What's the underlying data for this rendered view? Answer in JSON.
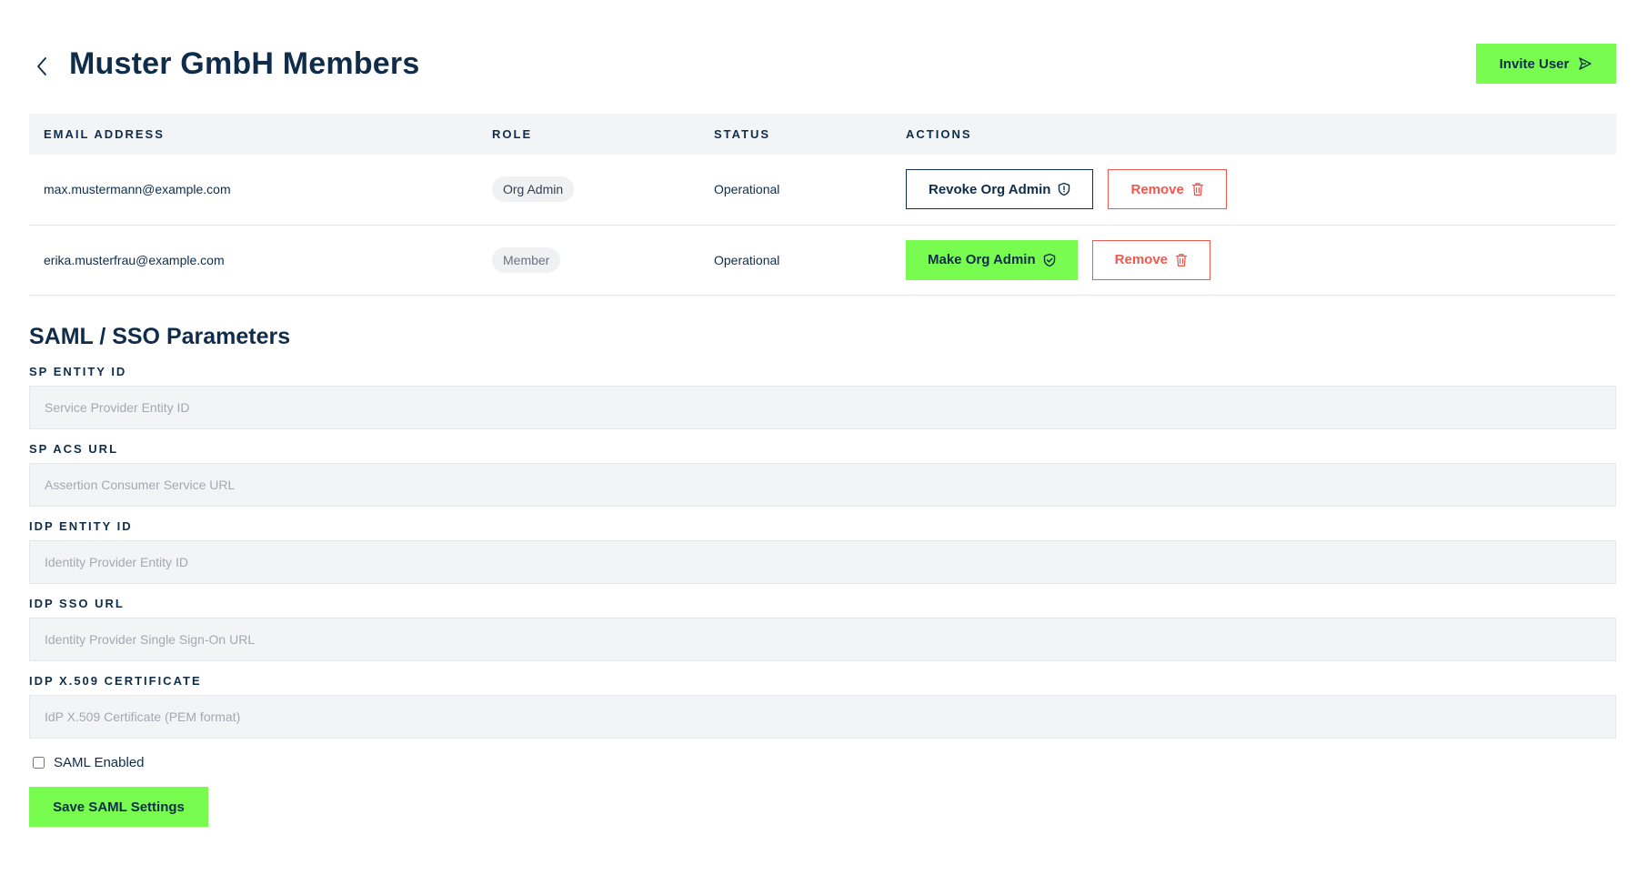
{
  "header": {
    "title": "Muster GmbH Members",
    "invite_label": "Invite User"
  },
  "table": {
    "columns": [
      "EMAIL ADDRESS",
      "ROLE",
      "STATUS",
      "ACTIONS"
    ],
    "rows": [
      {
        "email": "max.mustermann@example.com",
        "role": "Org Admin",
        "status": "Operational",
        "admin_action": "Revoke Org Admin",
        "remove_label": "Remove"
      },
      {
        "email": "erika.musterfrau@example.com",
        "role": "Member",
        "status": "Operational",
        "admin_action": "Make Org Admin",
        "remove_label": "Remove"
      }
    ]
  },
  "saml": {
    "title": "SAML / SSO Parameters",
    "fields": [
      {
        "label": "SP ENTITY ID",
        "value": "",
        "placeholder": "Service Provider Entity ID"
      },
      {
        "label": "SP ACS URL",
        "value": "",
        "placeholder": "Assertion Consumer Service URL"
      },
      {
        "label": "IDP ENTITY ID",
        "value": "",
        "placeholder": "Identity Provider Entity ID"
      },
      {
        "label": "IDP SSO URL",
        "value": "",
        "placeholder": "Identity Provider Single Sign-On URL"
      },
      {
        "label": "IDP X.509 CERTIFICATE",
        "value": "",
        "placeholder": "IdP X.509 Certificate (PEM format)"
      }
    ],
    "enabled_label": "SAML Enabled",
    "enabled": false,
    "save_label": "Save SAML Settings"
  },
  "colors": {
    "accent_green": "#77fc4f",
    "navy": "#0f2d4a",
    "danger": "#f0584d",
    "surface": "#f3f4f6"
  },
  "icons": {
    "back": "chevron-left-icon",
    "invite": "send-icon",
    "revoke": "shield-icon",
    "make_admin": "shield-check-icon",
    "remove": "trash-icon"
  }
}
